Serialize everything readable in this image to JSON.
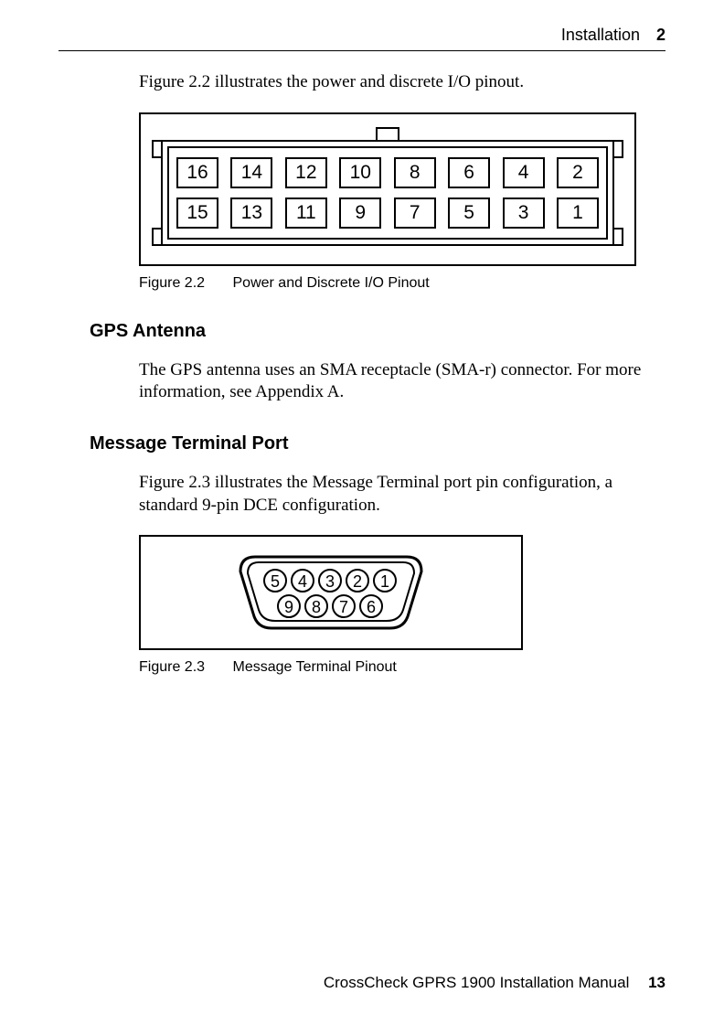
{
  "header": {
    "section": "Installation",
    "chapter": "2"
  },
  "intro": "Figure 2.2 illustrates the power and discrete I/O pinout.",
  "fig22": {
    "pins_top": [
      "16",
      "14",
      "12",
      "10",
      "8",
      "6",
      "4",
      "2"
    ],
    "pins_bottom": [
      "15",
      "13",
      "11",
      "9",
      "7",
      "5",
      "3",
      "1"
    ],
    "caption_num": "Figure 2.2",
    "caption_text": "Power and Discrete I/O Pinout"
  },
  "sectionA": {
    "title": "GPS Antenna",
    "body": "The GPS antenna uses an SMA receptacle (SMA-r) connector. For more information, see Appendix A."
  },
  "sectionB": {
    "title": "Message Terminal Port",
    "body": "Figure 2.3 illustrates the Message Terminal port pin configuration, a standard 9-pin DCE configuration."
  },
  "fig23": {
    "pins_top": [
      "5",
      "4",
      "3",
      "2",
      "1"
    ],
    "pins_bottom": [
      "9",
      "8",
      "7",
      "6"
    ],
    "caption_num": "Figure 2.3",
    "caption_text": "Message Terminal Pinout"
  },
  "footer": {
    "manual": "CrossCheck GPRS 1900 Installation Manual",
    "page": "13"
  }
}
